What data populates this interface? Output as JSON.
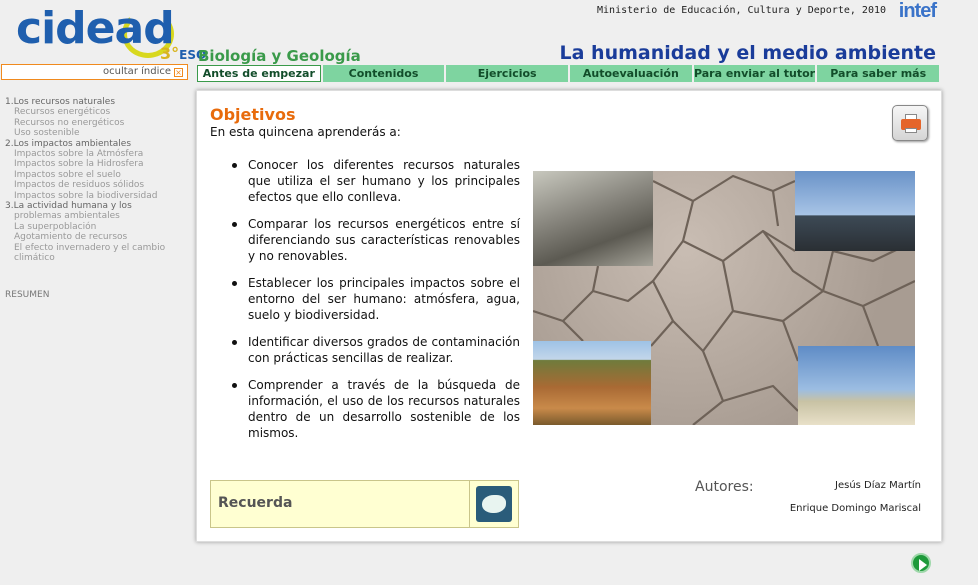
{
  "header": {
    "logo_text": "cidead",
    "logo_grade": "3°",
    "logo_level": "ESO",
    "ministry": "Ministerio de Educación, Cultura y Deporte, 2010",
    "intef": "intef",
    "subject": "Biología y Geología",
    "unit_title": "La humanidad y el medio ambiente",
    "hide_index": "ocultar índice"
  },
  "tabs": [
    {
      "label": "Antes de empezar",
      "active": true
    },
    {
      "label": "Contenidos"
    },
    {
      "label": "Ejercicios"
    },
    {
      "label": "Autoevaluación"
    },
    {
      "label": "Para enviar al tutor"
    },
    {
      "label": "Para saber más"
    }
  ],
  "sidebar": {
    "items": [
      {
        "label": "1.Los recursos naturales",
        "level": 0
      },
      {
        "label": "Recursos energéticos",
        "level": 1
      },
      {
        "label": "Recursos no energéticos",
        "level": 1
      },
      {
        "label": "Uso sostenible",
        "level": 1
      },
      {
        "label": "2.Los impactos ambientales",
        "level": 0
      },
      {
        "label": "Impactos sobre la Atmósfera",
        "level": 1
      },
      {
        "label": "Impactos sobre la Hidrosfera",
        "level": 1
      },
      {
        "label": "Impactos sobre el suelo",
        "level": 1
      },
      {
        "label": "Impactos de residuos sólidos",
        "level": 1
      },
      {
        "label": "Impactos sobre la biodiversidad",
        "level": 1
      },
      {
        "label": "3.La actividad humana y los",
        "level": 0
      },
      {
        "label": "problemas ambientales",
        "level": 1
      },
      {
        "label": "La superpoblación",
        "level": 1
      },
      {
        "label": "Agotamiento de recursos",
        "level": 1
      },
      {
        "label": "El efecto invernadero y el cambio",
        "level": 1
      },
      {
        "label": "climático",
        "level": 1
      }
    ],
    "summary": "RESUMEN"
  },
  "main": {
    "title": "Objetivos",
    "intro": "En esta quincena aprenderás a:",
    "objectives": [
      "Conocer los diferentes recursos naturales que utiliza el ser humano y los principales efectos que ello conlleva.",
      "Comparar los recursos energéticos entre sí diferenciando sus características renovables y no renovables.",
      "Establecer los principales impactos sobre el entorno del ser humano: atmósfera, agua, suelo y biodiversidad.",
      "Identificar diversos grados de contaminación con prácticas sencillas de realizar.",
      "Comprender a través de la búsqueda de información, el uso de los recursos naturales dentro de un desarrollo sostenible de los mismos."
    ],
    "recuerda": "Recuerda",
    "authors_label": "Autores:",
    "authors": [
      "Jesús Díaz Martín",
      "Enrique Domingo Mariscal"
    ]
  },
  "icons": {
    "print": "printer-icon",
    "recuerda": "globe-icon",
    "next": "play-next-icon"
  },
  "colors": {
    "tab_bg": "#7ed4a0",
    "title_orange": "#e86b0c",
    "unit_blue": "#1a3c9a",
    "subject_green": "#3a9a4a",
    "recuerda_bg": "#ffffd2"
  }
}
